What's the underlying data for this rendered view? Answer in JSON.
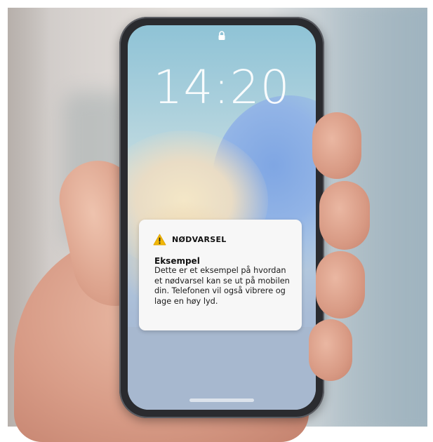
{
  "lockscreen": {
    "time": "14:20",
    "lock_icon": "lock-icon"
  },
  "notification": {
    "icon": "warning-icon",
    "icon_color": "#f2b705",
    "category": "NØDVARSEL",
    "title": "Eksempel",
    "body": "Dette er et eksempel på hvordan et nødvarsel kan se ut på mobilen din. Telefonen vil også vibrere og lage en høy lyd."
  }
}
